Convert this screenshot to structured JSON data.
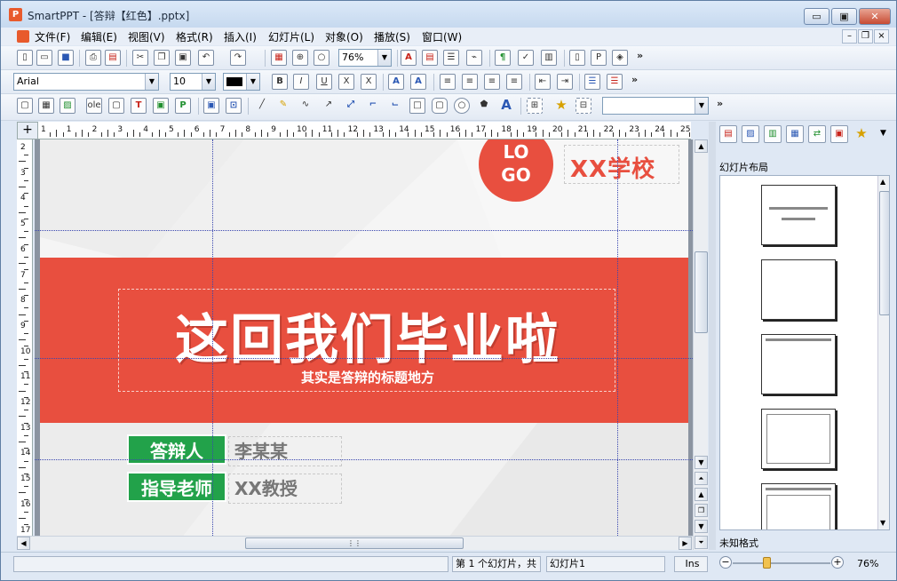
{
  "window": {
    "title": "SmartPPT - [答辩【红色】.pptx]",
    "app_icon_letter": "P",
    "minimize": "▭",
    "maximize": "▣",
    "close": "✕"
  },
  "menu": {
    "items": [
      "文件(F)",
      "编辑(E)",
      "视图(V)",
      "格式(R)",
      "插入(I)",
      "幻灯片(L)",
      "对象(O)",
      "播放(S)",
      "窗口(W)"
    ],
    "mdi_min": "–",
    "mdi_restore": "❐",
    "mdi_close": "×"
  },
  "toolbar1": {
    "zoom_value": "76%",
    "more": "»"
  },
  "toolbar2": {
    "font_value": "Arial",
    "size_value": "10",
    "more": "»"
  },
  "toolbar3": {
    "style_value": "",
    "more": "»"
  },
  "ruler": {
    "h_labels": [
      "1",
      "1",
      "2",
      "3",
      "4",
      "5",
      "6",
      "7",
      "8",
      "9",
      "10",
      "11",
      "12",
      "13",
      "14",
      "15",
      "16",
      "17",
      "18",
      "19",
      "20",
      "21",
      "22",
      "23",
      "24",
      "25"
    ],
    "v_labels": [
      "2",
      "3",
      "4",
      "5",
      "6",
      "7",
      "8",
      "9",
      "10",
      "11",
      "12",
      "13",
      "14",
      "15",
      "16",
      "17"
    ],
    "corner": "+"
  },
  "slide": {
    "logo_line1": "LO",
    "logo_line2": "GO",
    "school": "XX学校",
    "title": "这回我们毕业啦",
    "subtitle": "其实是答辩的标题地方",
    "defender_label": "答辩人",
    "defender_value": "李某某",
    "advisor_label": "指导老师",
    "advisor_value": "XX教授"
  },
  "panel": {
    "title": "幻灯片布局",
    "footer": "未知格式"
  },
  "status": {
    "left": "",
    "slide_info": "第 1 个幻灯片，共",
    "slide_name": "幻灯片1",
    "mode": "Ins",
    "zoom": "76%"
  },
  "colors": {
    "accent": "#e84f3f",
    "tag_green": "#22a24a"
  }
}
